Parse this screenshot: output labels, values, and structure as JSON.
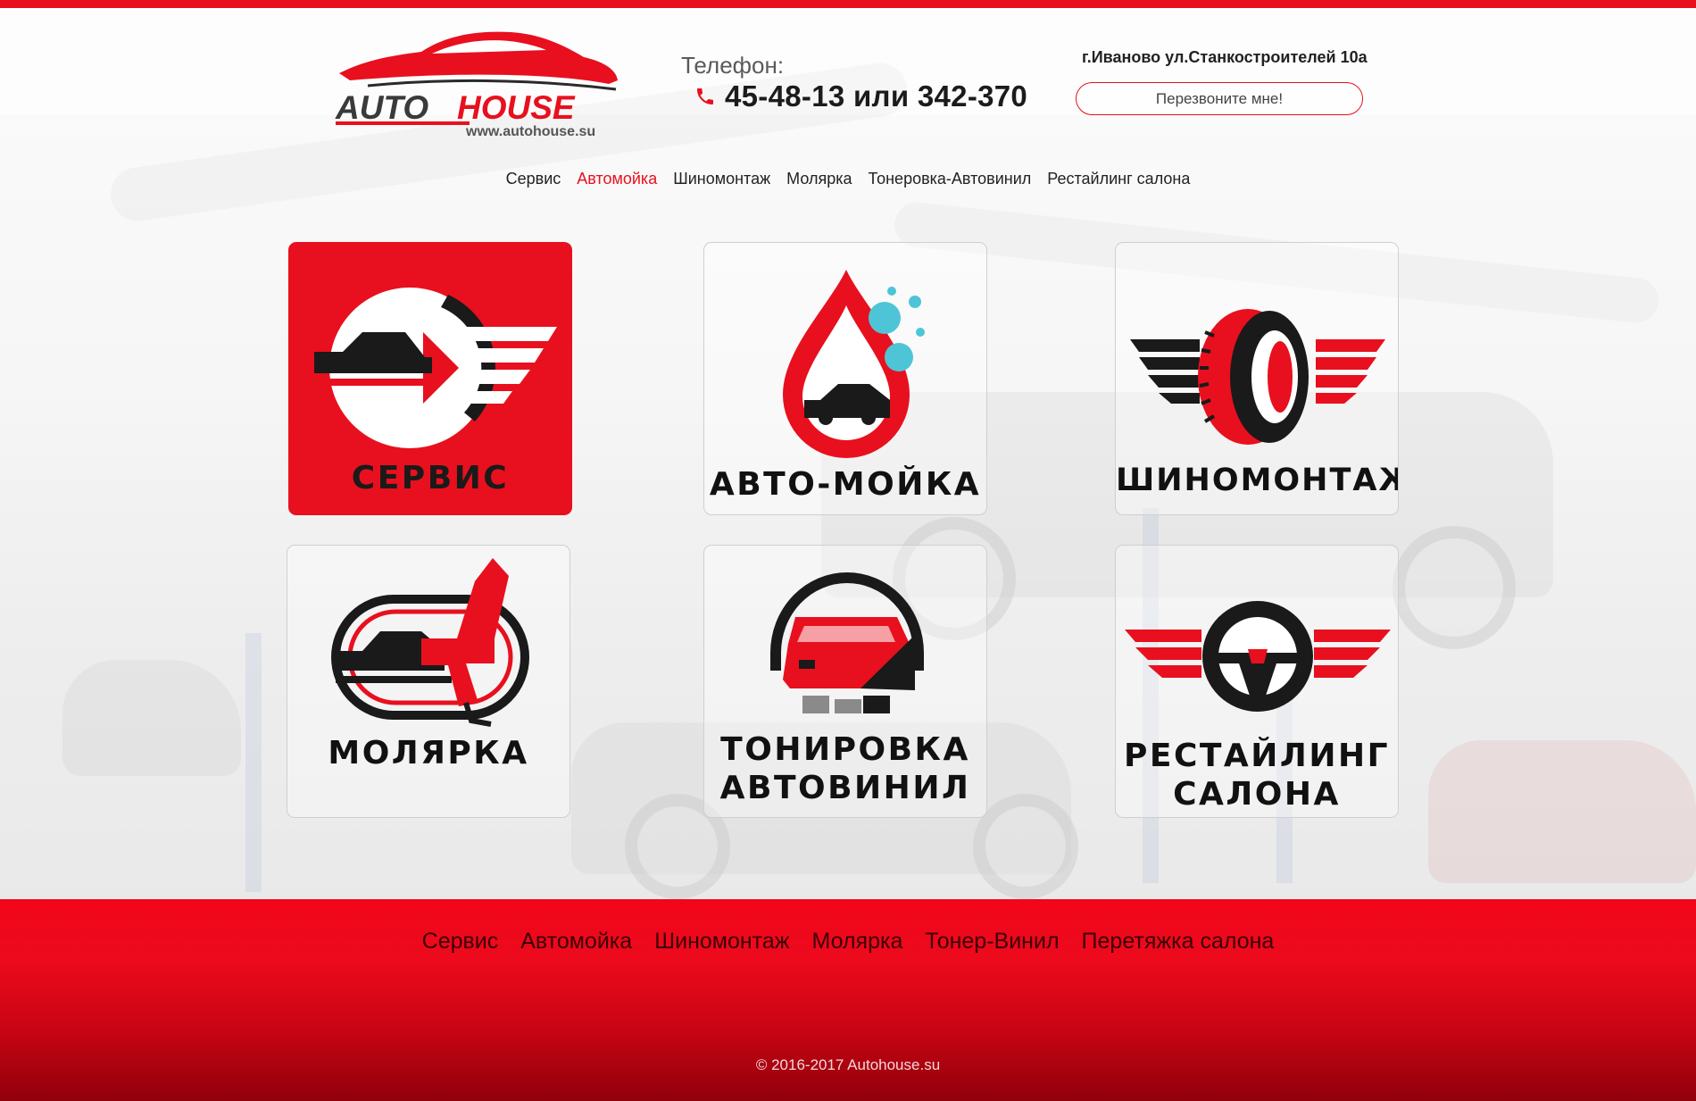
{
  "brand": {
    "logo_text_1": "AUTO",
    "logo_text_2": "HOUSE",
    "logo_url": "www.autohouse.su"
  },
  "header": {
    "phone_label": "Телефон:",
    "phone_number": "45-48-13 или 342-370",
    "address": "г.Иваново ул.Станкостроителей 10а",
    "callback_label": "Перезвоните мне!"
  },
  "top_nav": [
    "Сервис",
    "Автомойка",
    "Шиномонтаж",
    "Молярка",
    "Тонеровка-Автовинил",
    "Рестайлинг салона"
  ],
  "top_nav_active": "Автомойка",
  "tiles": [
    {
      "label": "СЕРВИС",
      "icon": "service-wrench-icon",
      "active": true
    },
    {
      "label": "АВТО-МОЙКА",
      "icon": "car-wash-drop-icon",
      "active": false
    },
    {
      "label": "ШИНОМОНТАЖ",
      "icon": "winged-tire-icon",
      "active": false
    },
    {
      "label": "МОЛЯРКА",
      "icon": "paint-spray-gun-icon",
      "active": false
    },
    {
      "label_line_1": "ТОНИРОВКА",
      "label_line_2": "АВТОВИНИЛ",
      "icon": "tinted-car-icon",
      "active": false
    },
    {
      "label_line_1": "РЕСТАЙЛИНГ",
      "label_line_2": "САЛОНА",
      "icon": "winged-steering-wheel-icon",
      "active": false
    }
  ],
  "footer_nav": [
    "Сервис",
    "Автомойка",
    "Шиномонтаж",
    "Молярка",
    "Тонер-Винил",
    "Перетяжка салона"
  ],
  "copyright": "© 2016-2017 Autohouse.su",
  "colors": {
    "accent": "#e8101e",
    "dark": "#111111",
    "aqua": "#4ec5d6"
  }
}
